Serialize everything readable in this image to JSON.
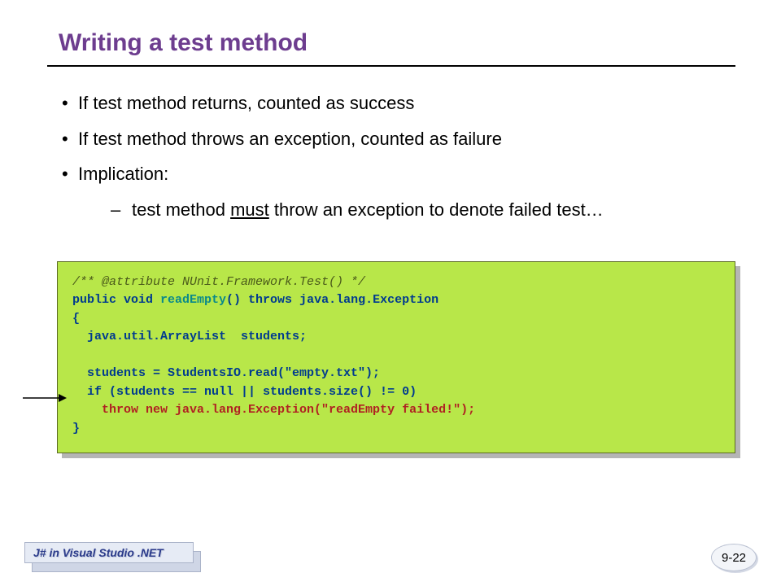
{
  "title": "Writing a test method",
  "bullets": {
    "b1": "If test method returns, counted as success",
    "b2": "If test method throws an exception, counted as failure",
    "b3": "Implication:",
    "sub1_pre": "test method ",
    "sub1_u": "must",
    "sub1_post": " throw an exception to denote failed test…"
  },
  "code": {
    "c1": "/** @attribute NUnit.Framework.Test() */",
    "c2a": "public void ",
    "c2b": "readEmpty",
    "c2c": "() throws java.lang.Exception",
    "c3": "{",
    "c4": "  java.util.ArrayList  students;",
    "c5": "",
    "c6": "  students = StudentsIO.read(\"empty.txt\");",
    "c7": "  if (students == null || students.size() != 0)",
    "c8": "    throw new java.lang.Exception(\"readEmpty failed!\");",
    "c9": "}"
  },
  "footer": {
    "label": "J# in Visual Studio .NET",
    "page": "9-22"
  }
}
